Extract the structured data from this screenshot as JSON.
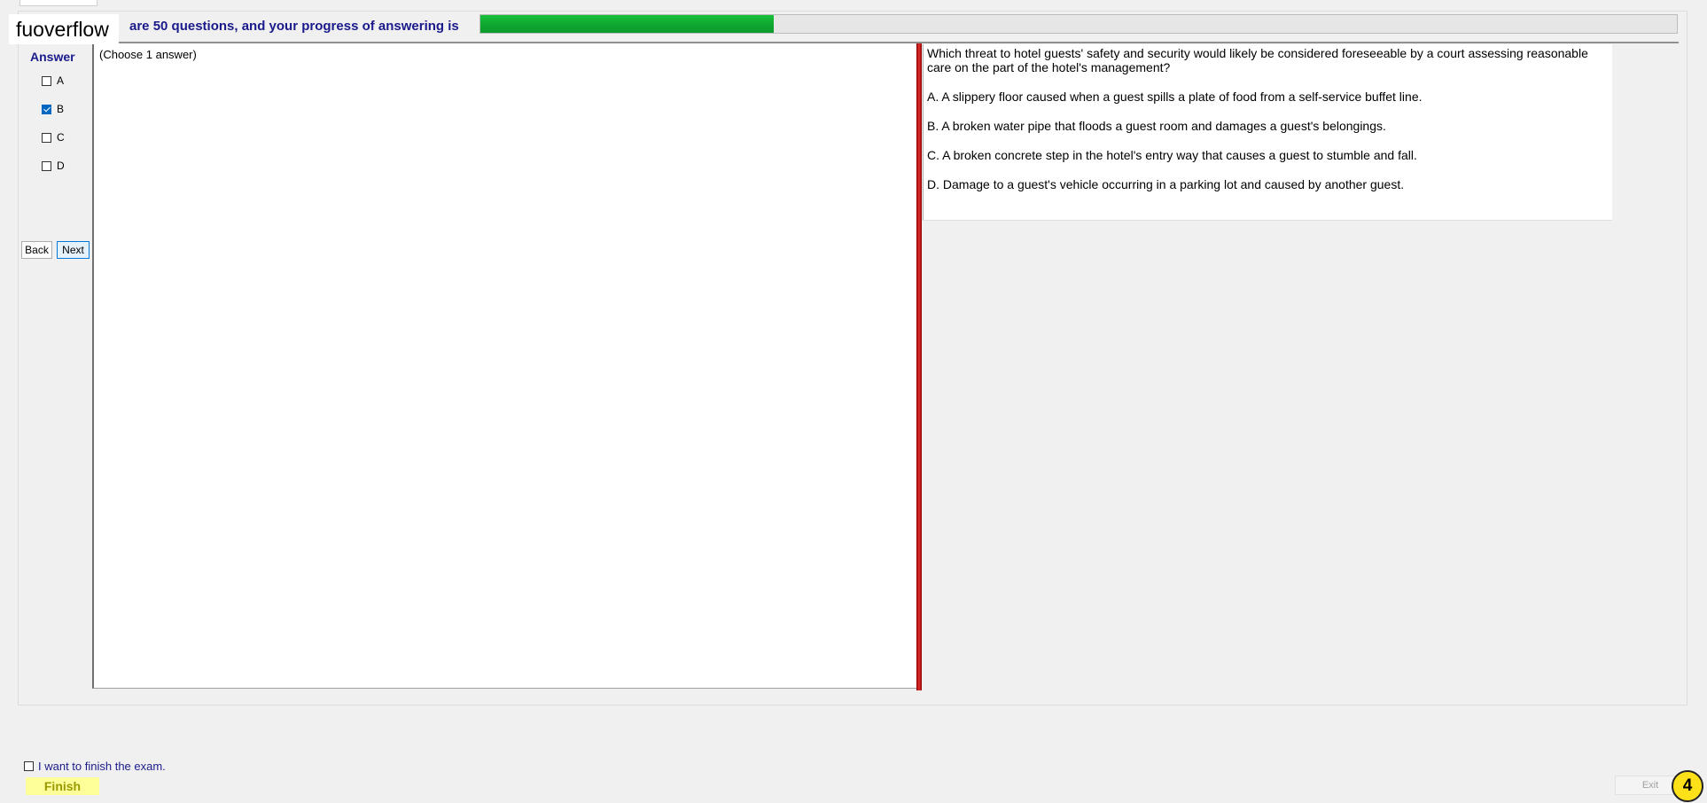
{
  "watermark": "fuoverflow",
  "progress": {
    "text": "are 50 questions, and your progress of answering is",
    "fraction": 0.245
  },
  "answer_panel": {
    "heading": "Answer",
    "options": [
      {
        "label": "A",
        "checked": false
      },
      {
        "label": "B",
        "checked": true
      },
      {
        "label": "C",
        "checked": false
      },
      {
        "label": "D",
        "checked": false
      }
    ],
    "back_label": "Back",
    "next_label": "Next"
  },
  "instruction": "(Choose 1 answer)",
  "question": {
    "text": "Which threat to hotel guests' safety and security would likely be considered foreseeable by a court assessing reasonable care on the part of the hotel's management?",
    "choices": [
      "A.  A slippery floor caused when a guest spills a plate of food from a self-service buffet line.",
      "B.  A broken water pipe that floods a guest room and damages a guest's belongings.",
      "C.  A broken concrete step in the hotel's entry way that causes a guest to stumble and fall.",
      "D.  Damage to a guest's vehicle occurring in a parking lot and caused by another guest."
    ]
  },
  "footer": {
    "finish_checkbox_label": "I want to finish the exam.",
    "finish_label": "Finish",
    "exit_label": "Exit",
    "step_badge": "4"
  }
}
